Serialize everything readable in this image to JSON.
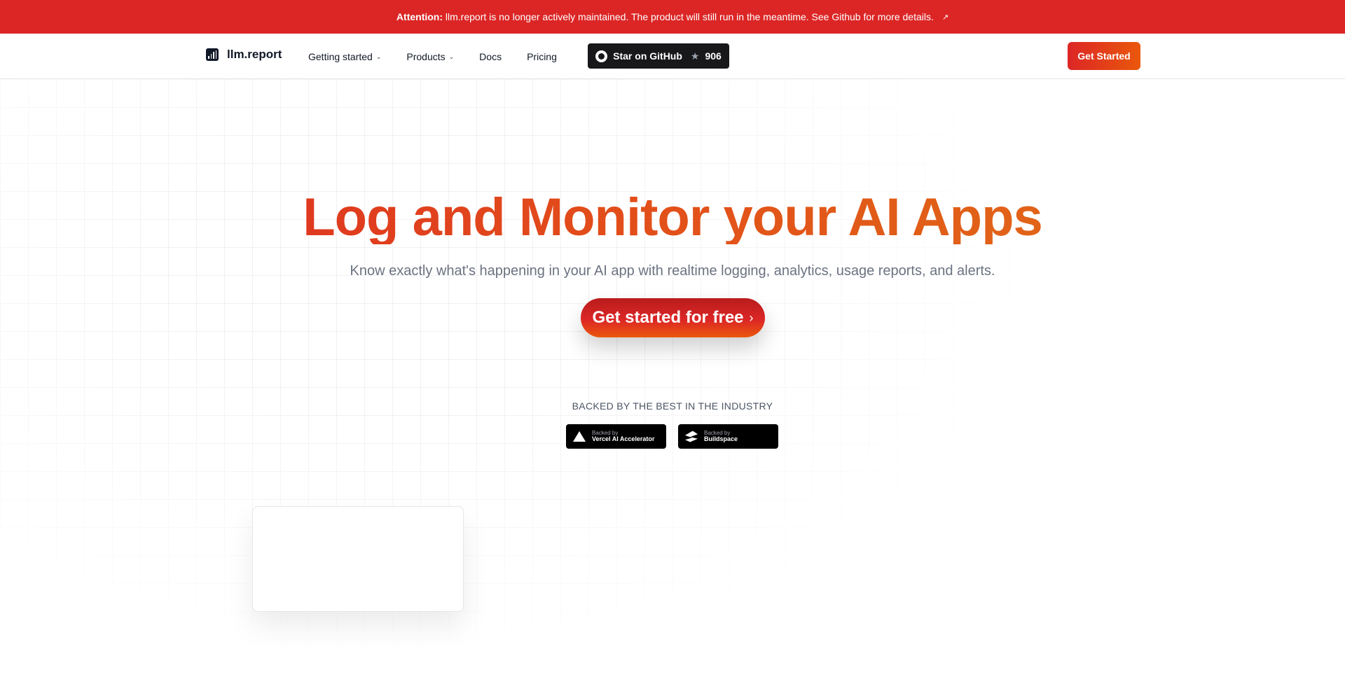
{
  "banner": {
    "prefix": "Attention:",
    "message": "llm.report is no longer actively maintained. The product will still run in the meantime. See Github for more details.",
    "icon": "external-link-icon"
  },
  "nav": {
    "brand": "llm.report",
    "links": [
      {
        "label": "Getting started",
        "dropdown": true
      },
      {
        "label": "Products",
        "dropdown": true
      },
      {
        "label": "Docs",
        "dropdown": false
      },
      {
        "label": "Pricing",
        "dropdown": false
      }
    ],
    "github": {
      "label": "Star on GitHub",
      "stars": "906"
    },
    "cta": "Get Started"
  },
  "hero": {
    "title": "Log and Monitor your AI Apps",
    "subtitle": "Know exactly what's happening in your AI app with realtime logging, analytics, usage reports, and alerts.",
    "cta": "Get started for free",
    "backed_heading": "BACKED BY THE BEST IN THE INDUSTRY",
    "badges": [
      {
        "small": "Backed by",
        "name": "Vercel AI Accelerator"
      },
      {
        "small": "Backed by",
        "name": "Buildspace"
      }
    ]
  },
  "colors": {
    "banner": "#dc2626",
    "accent_start": "#dc2626",
    "accent_end": "#ea580c",
    "dark": "#18181b"
  }
}
